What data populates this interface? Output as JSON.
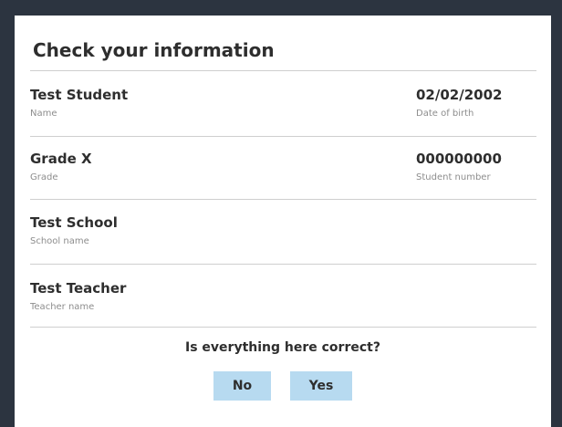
{
  "dialog": {
    "title": "Check your information",
    "question": "Is everything here correct?",
    "buttons": {
      "no": "No",
      "yes": "Yes"
    }
  },
  "fields": {
    "name": {
      "value": "Test Student",
      "caption": "Name"
    },
    "dob": {
      "value": "02/02/2002",
      "caption": "Date of birth"
    },
    "grade": {
      "value": "Grade X",
      "caption": "Grade"
    },
    "student_number": {
      "value": "000000000",
      "caption": "Student number"
    },
    "school": {
      "value": "Test School",
      "caption": "School name"
    },
    "teacher": {
      "value": "Test Teacher",
      "caption": "Teacher name"
    }
  },
  "colors": {
    "frame": "#2c3440",
    "button_bg": "#b7daf0",
    "text": "#2e2e2e",
    "caption": "#8d8d8d",
    "divider": "#cfcfcf"
  }
}
